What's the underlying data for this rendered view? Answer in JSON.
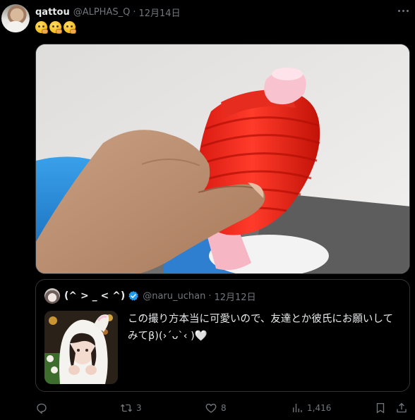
{
  "tweet": {
    "author_name": "qattou",
    "author_handle": "@ALPHAS_Q",
    "separator": "·",
    "timestamp": "12月14日",
    "text_emojis": [
      "thinking-face-emoji",
      "thinking-face-emoji",
      "thinking-face-emoji"
    ]
  },
  "media": {
    "image": "photo-hand-holding-red-ribbed-bottle-cap"
  },
  "quoted_tweet": {
    "author_name": "(^ > _ < ^)",
    "author_handle": "@naru_uchan",
    "separator": "·",
    "timestamp": "12月12日",
    "verified": true,
    "text": "この撮り方本当に可愛いので、友達とか彼氏にお願いしてみてβ)(›´ᴗ`‹ )🤍",
    "thumbnail": "photo-girl-in-white-bunny-hood"
  },
  "actions": {
    "reply_count": "",
    "retweet_count": "3",
    "like_count": "8",
    "view_count": "1,416"
  },
  "colors": {
    "background": "#000000",
    "text": "#e7e9ea",
    "muted": "#71767b",
    "border": "#2f3336",
    "verified_blue": "#1d9bf0"
  }
}
